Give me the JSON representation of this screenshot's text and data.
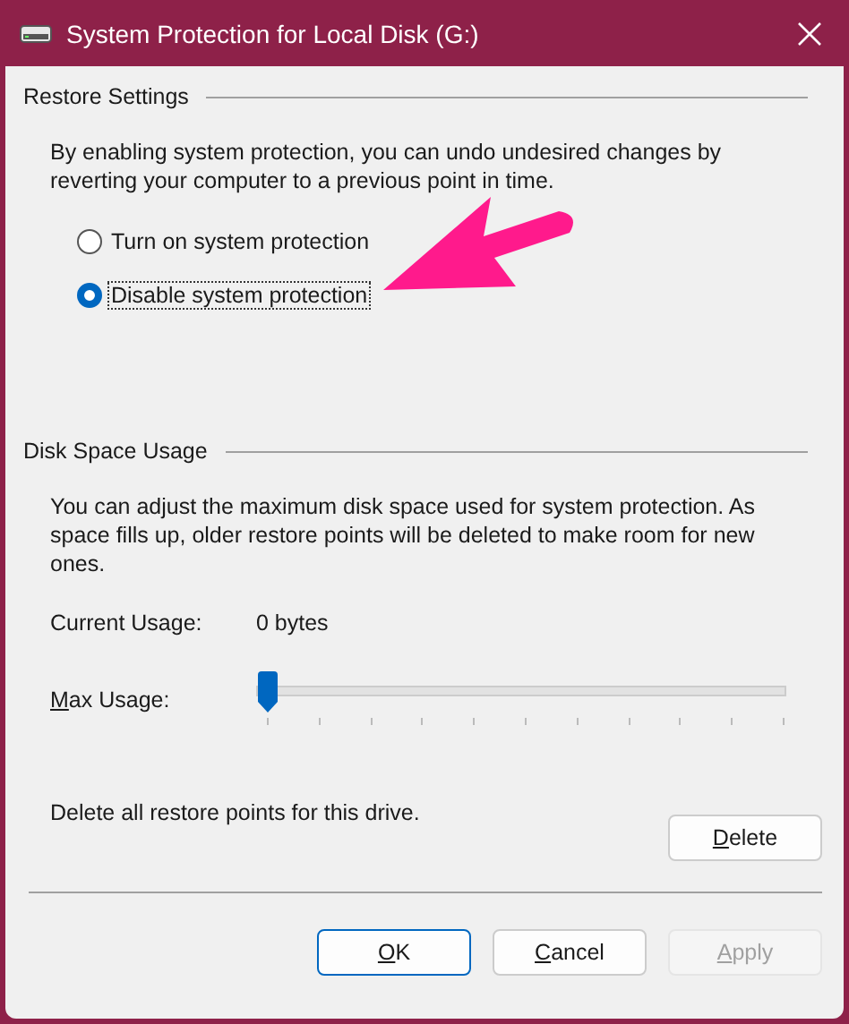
{
  "window": {
    "title": "System Protection for Local Disk (G:)"
  },
  "restore_settings": {
    "heading": "Restore Settings",
    "description": "By enabling system protection, you can undo undesired changes by reverting your computer to a previous point in time.",
    "options": [
      {
        "label": "Turn on system protection",
        "selected": false
      },
      {
        "label": "Disable system protection",
        "selected": true
      }
    ]
  },
  "disk_space_usage": {
    "heading": "Disk Space Usage",
    "description": "You can adjust the maximum disk space used for system protection. As space fills up, older restore points will be deleted to make room for new ones.",
    "current_usage_label": "Current Usage:",
    "current_usage_value": "0 bytes",
    "max_usage": {
      "label": "Max Usage:",
      "mnemonic": true,
      "level": 0
    },
    "delete_text": "Delete all restore points for this drive.",
    "delete_button": {
      "label": "Delete",
      "mnemonic": true,
      "disabled": false
    }
  },
  "buttons": [
    {
      "label": "OK",
      "mnemonic": true,
      "disabled": false,
      "default": true
    },
    {
      "label": "Cancel",
      "mnemonic": true,
      "disabled": false,
      "default": false
    },
    {
      "label": "Apply",
      "mnemonic": true,
      "disabled": true,
      "default": false
    }
  ]
}
